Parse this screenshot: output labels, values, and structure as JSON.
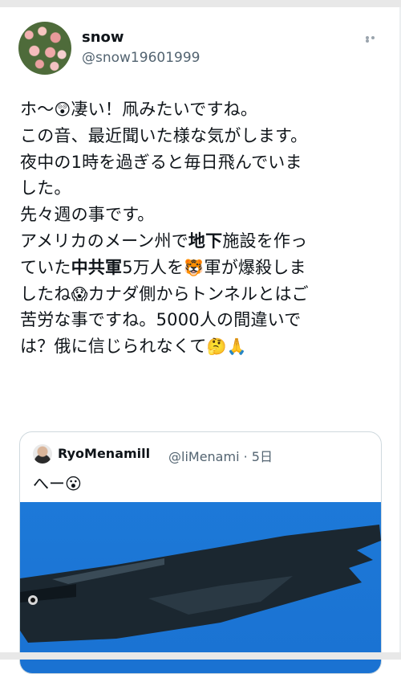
{
  "tweet": {
    "display_name": "snow",
    "handle": "@snow19601999",
    "text_segments": [
      {
        "t": "ホ〜"
      },
      {
        "e": "😲"
      },
      {
        "t": "凄い！凧みたいですね。\nこの音、最近聞いた様な気がします。\n夜中の1時を過ぎると毎日飛んでいま\nした。\n先々週の事です。\nアメリカのメーン州で"
      },
      {
        "b": "地下"
      },
      {
        "t": "施設を作っ\nていた"
      },
      {
        "b": "中共軍"
      },
      {
        "t": "5万人を"
      },
      {
        "e": "🐯"
      },
      {
        "t": "軍が爆殺しま\nしたね"
      },
      {
        "e": "😱"
      },
      {
        "t": "カナダ側からトンネルとはご\n苦労な事ですね。5000人の間違いで\nは？俄に信じられなくて"
      },
      {
        "e": "🤔"
      },
      {
        "e": "🙏"
      }
    ]
  },
  "quote": {
    "display_name": "RyoMenamill",
    "meta": "@liMenami · 5日",
    "text": "へー",
    "text_emoji": "😮"
  },
  "icons": {
    "more": "more-icon",
    "quote_avatar": "avatar"
  }
}
